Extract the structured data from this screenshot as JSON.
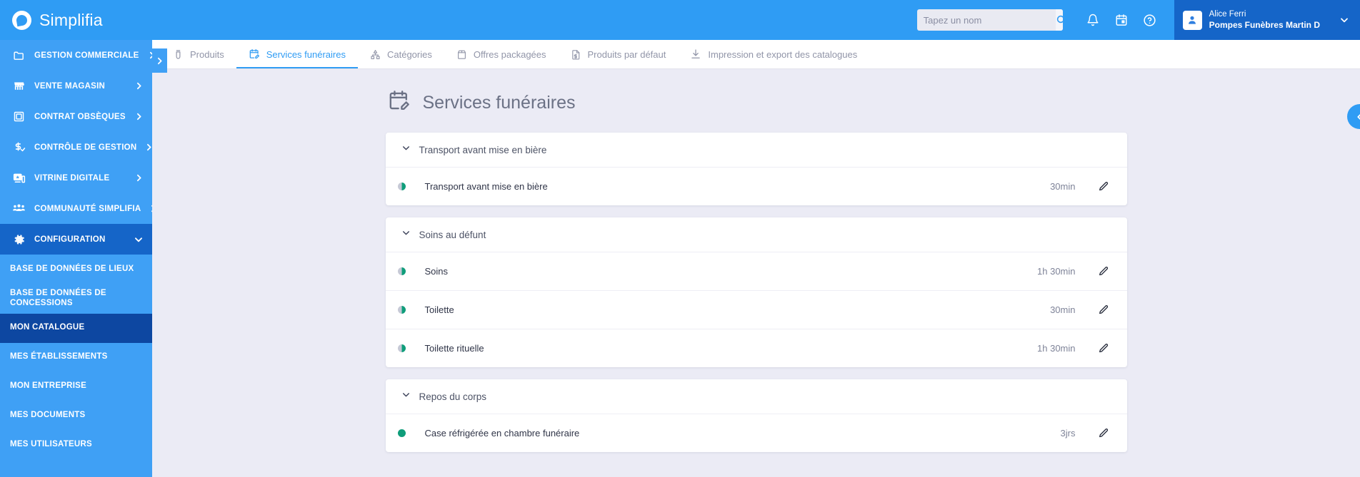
{
  "brand": {
    "name": "Simplifia",
    "logo_icon": "simplifia-logo-icon"
  },
  "header": {
    "search": {
      "placeholder": "Tapez un nom",
      "value": "",
      "icon": "search-icon"
    },
    "notifications_icon": "bell-icon",
    "calendar_icon": "calendar-icon",
    "help_icon": "help-circle-icon",
    "user": {
      "avatar_icon": "user-avatar-icon",
      "name": "Alice Ferri",
      "organization": "Pompes Funèbres Martin D",
      "caret_icon": "chevron-down-icon"
    }
  },
  "sidebar": {
    "expand_icon": "chevron-right-icon",
    "items": [
      {
        "label": "GESTION COMMERCIALE",
        "icon": "folder-icon",
        "chevron": "chevron-right-icon",
        "open": false
      },
      {
        "label": "VENTE MAGASIN",
        "icon": "store-icon",
        "chevron": "chevron-right-icon",
        "open": false
      },
      {
        "label": "CONTRAT OBSÈQUES",
        "icon": "contract-icon",
        "chevron": "chevron-right-icon",
        "open": false
      },
      {
        "label": "CONTRÔLE DE GESTION",
        "icon": "currency-check-icon",
        "chevron": "chevron-right-icon",
        "open": false
      },
      {
        "label": "VITRINE DIGITALE",
        "icon": "digital-display-icon",
        "chevron": "chevron-right-icon",
        "open": false
      },
      {
        "label": "COMMUNAUTÉ SIMPLIFIA",
        "icon": "people-group-icon",
        "chevron": "chevron-right-icon",
        "open": false
      },
      {
        "label": "CONFIGURATION",
        "icon": "gear-icon",
        "chevron": "chevron-down-icon",
        "open": true
      }
    ],
    "sub_items": [
      {
        "label": "BASE DE DONNÉES DE LIEUX",
        "active": false
      },
      {
        "label": "BASE DE DONNÉES DE CONCESSIONS",
        "active": false
      },
      {
        "label": "MON CATALOGUE",
        "active": true
      },
      {
        "label": "MES ÉTABLISSEMENTS",
        "active": false
      },
      {
        "label": "MON ENTREPRISE",
        "active": false
      },
      {
        "label": "MES DOCUMENTS",
        "active": false
      },
      {
        "label": "MES UTILISATEURS",
        "active": false
      }
    ]
  },
  "tabs": [
    {
      "label": "Produits",
      "icon": "urn-icon",
      "active": false
    },
    {
      "label": "Services funéraires",
      "icon": "calendar-edit-icon",
      "active": true
    },
    {
      "label": "Catégories",
      "icon": "hierarchy-icon",
      "active": false
    },
    {
      "label": "Offres packagées",
      "icon": "package-icon",
      "active": false
    },
    {
      "label": "Produits par défaut",
      "icon": "document-price-icon",
      "active": false
    },
    {
      "label": "Impression et export des catalogues",
      "icon": "download-icon",
      "active": false
    }
  ],
  "page": {
    "title": "Services funéraires",
    "title_icon": "calendar-edit-icon",
    "collapse_fab_icon": "chevron-left-icon"
  },
  "sections": [
    {
      "title": "Transport avant mise en bière",
      "chevron": "chevron-down-icon",
      "rows": [
        {
          "name": "Transport avant mise en bière",
          "duration": "30min",
          "status": "half",
          "edit_icon": "pencil-icon"
        }
      ]
    },
    {
      "title": "Soins au défunt",
      "chevron": "chevron-down-icon",
      "rows": [
        {
          "name": "Soins",
          "duration": "1h 30min",
          "status": "half",
          "edit_icon": "pencil-icon"
        },
        {
          "name": "Toilette",
          "duration": "30min",
          "status": "half",
          "edit_icon": "pencil-icon"
        },
        {
          "name": "Toilette rituelle",
          "duration": "1h 30min",
          "status": "half",
          "edit_icon": "pencil-icon"
        }
      ]
    },
    {
      "title": "Repos du corps",
      "chevron": "chevron-down-icon",
      "rows": [
        {
          "name": "Case réfrigérée en chambre funéraire",
          "duration": "3jrs",
          "status": "full",
          "edit_icon": "pencil-icon"
        }
      ]
    }
  ],
  "colors": {
    "brand_blue": "#2f9cf4",
    "sidebar_blue": "#3fa0f5",
    "sidebar_open": "#1565c8",
    "sidebar_active": "#0d47a1",
    "page_bg": "#ebebf5",
    "status_green": "#0f9d7a",
    "status_grey": "#c6c9d6"
  }
}
